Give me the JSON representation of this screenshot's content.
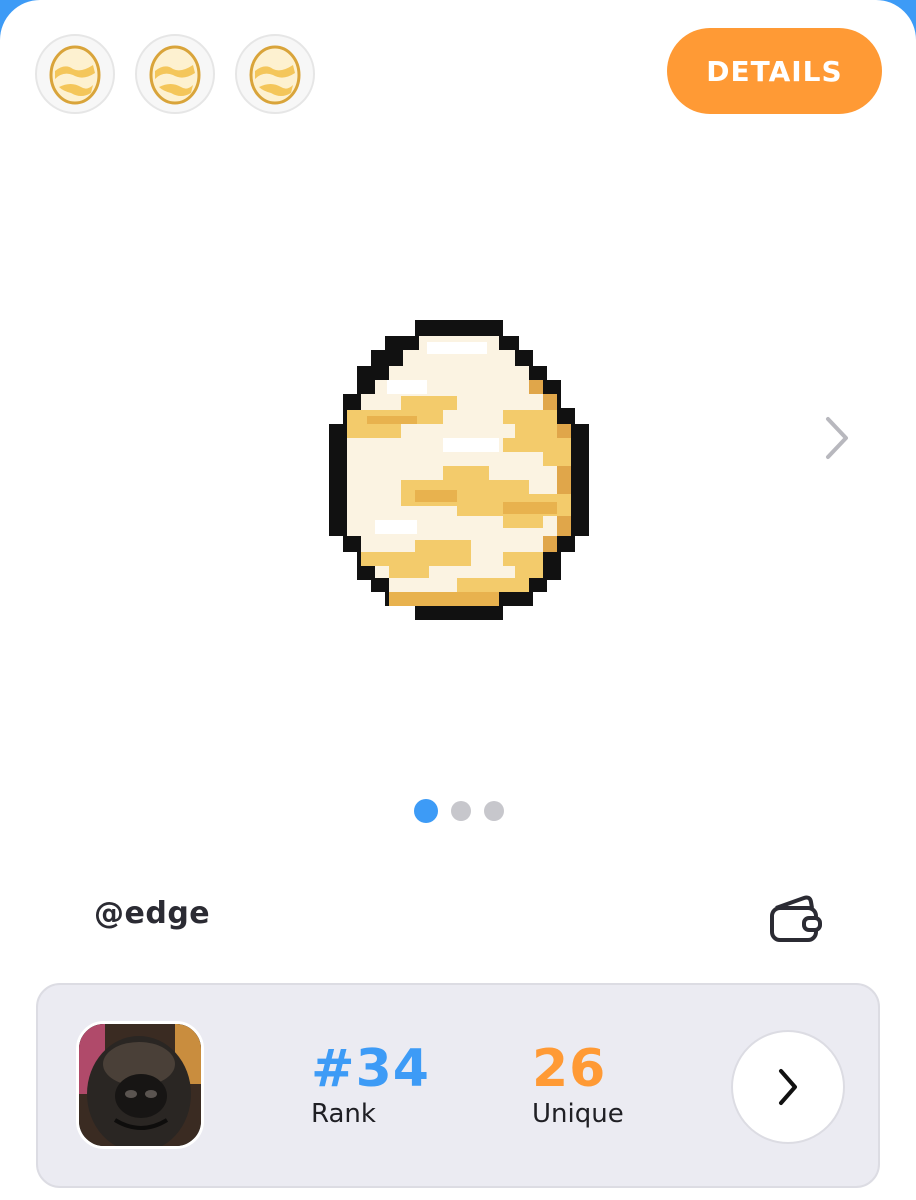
{
  "header": {
    "thumbnails": [
      {
        "icon": "egg-icon"
      },
      {
        "icon": "egg-icon"
      },
      {
        "icon": "egg-icon"
      }
    ],
    "details_label": "DETAILS",
    "details_color": "#ff9a35"
  },
  "carousel": {
    "image_icon": "pixel-egg-icon",
    "next_icon": "chevron-right-icon",
    "page_count": 3,
    "active_page": 1
  },
  "owner": {
    "handle": "@edge",
    "wallet_icon": "wallet-icon"
  },
  "stats": {
    "avatar_icon": "dog-avatar",
    "rank_value": "#34",
    "rank_label": "Rank",
    "rank_color": "#3d9bf6",
    "unique_value": "26",
    "unique_label": "Unique",
    "unique_color": "#ff9a35",
    "go_icon": "chevron-right-icon"
  }
}
